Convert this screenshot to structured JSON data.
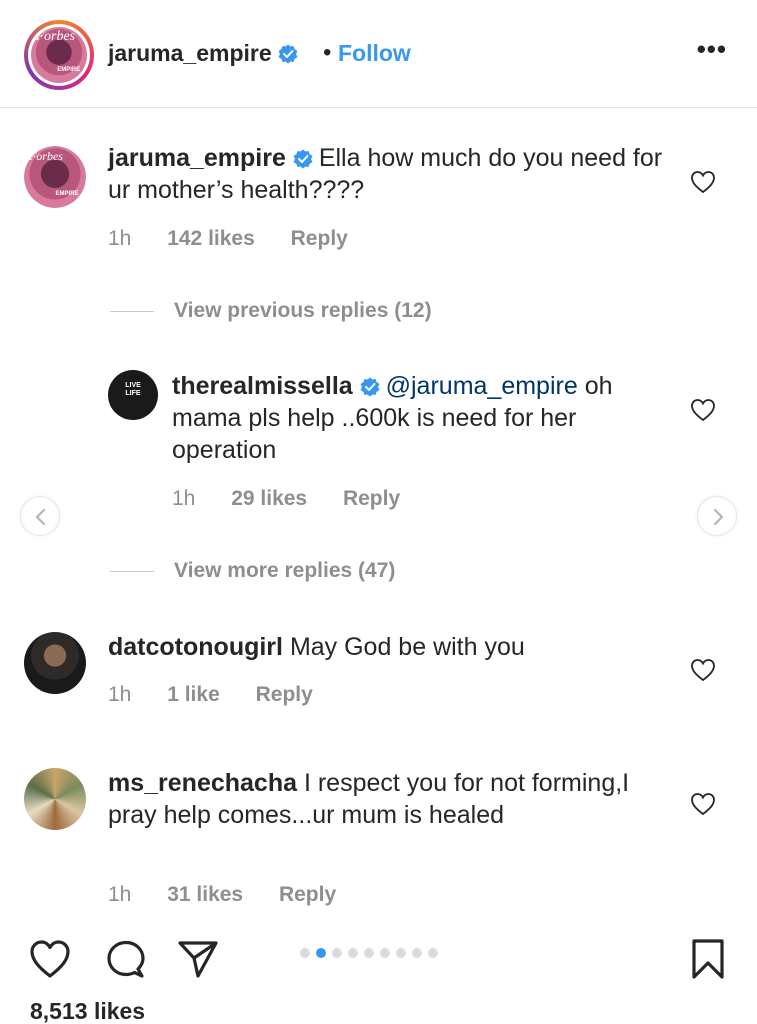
{
  "header": {
    "username": "jaruma_empire",
    "follow_label": "Follow",
    "separator": "•",
    "more_label": "•••"
  },
  "comments": [
    {
      "username": "jaruma_empire",
      "text": "Ella how much do you need for ur mother’s health????",
      "time": "1h",
      "likes": "142 likes",
      "reply": "Reply"
    },
    {
      "username": "therealmissella",
      "mention": "@jaruma_empire",
      "text": "oh mama pls help ..600k is need for her operation",
      "time": "1h",
      "likes": "29 likes",
      "reply": "Reply"
    },
    {
      "username": "datcotonougirl",
      "text": "May God be with you",
      "time": "1h",
      "likes": "1 like",
      "reply": "Reply"
    },
    {
      "username": "ms_renechacha",
      "text": "I respect you for not forming,I pray help comes...ur mum is healed",
      "time": "1h",
      "likes": "31 likes",
      "reply": "Reply"
    }
  ],
  "threads": {
    "previous": "View previous replies (12)",
    "more": "View more replies (47)"
  },
  "avatar_text": {
    "brand": "Forbes",
    "sub": "EMPIRE",
    "ella": "LIVE LIFE"
  },
  "footer": {
    "likes_total": "8,513 likes",
    "carousel_active_index": 1,
    "carousel_count": 9
  },
  "colors": {
    "link": "#3897f0",
    "verified": "#3897f0",
    "muted": "#8e8e8e",
    "text": "#262626"
  }
}
